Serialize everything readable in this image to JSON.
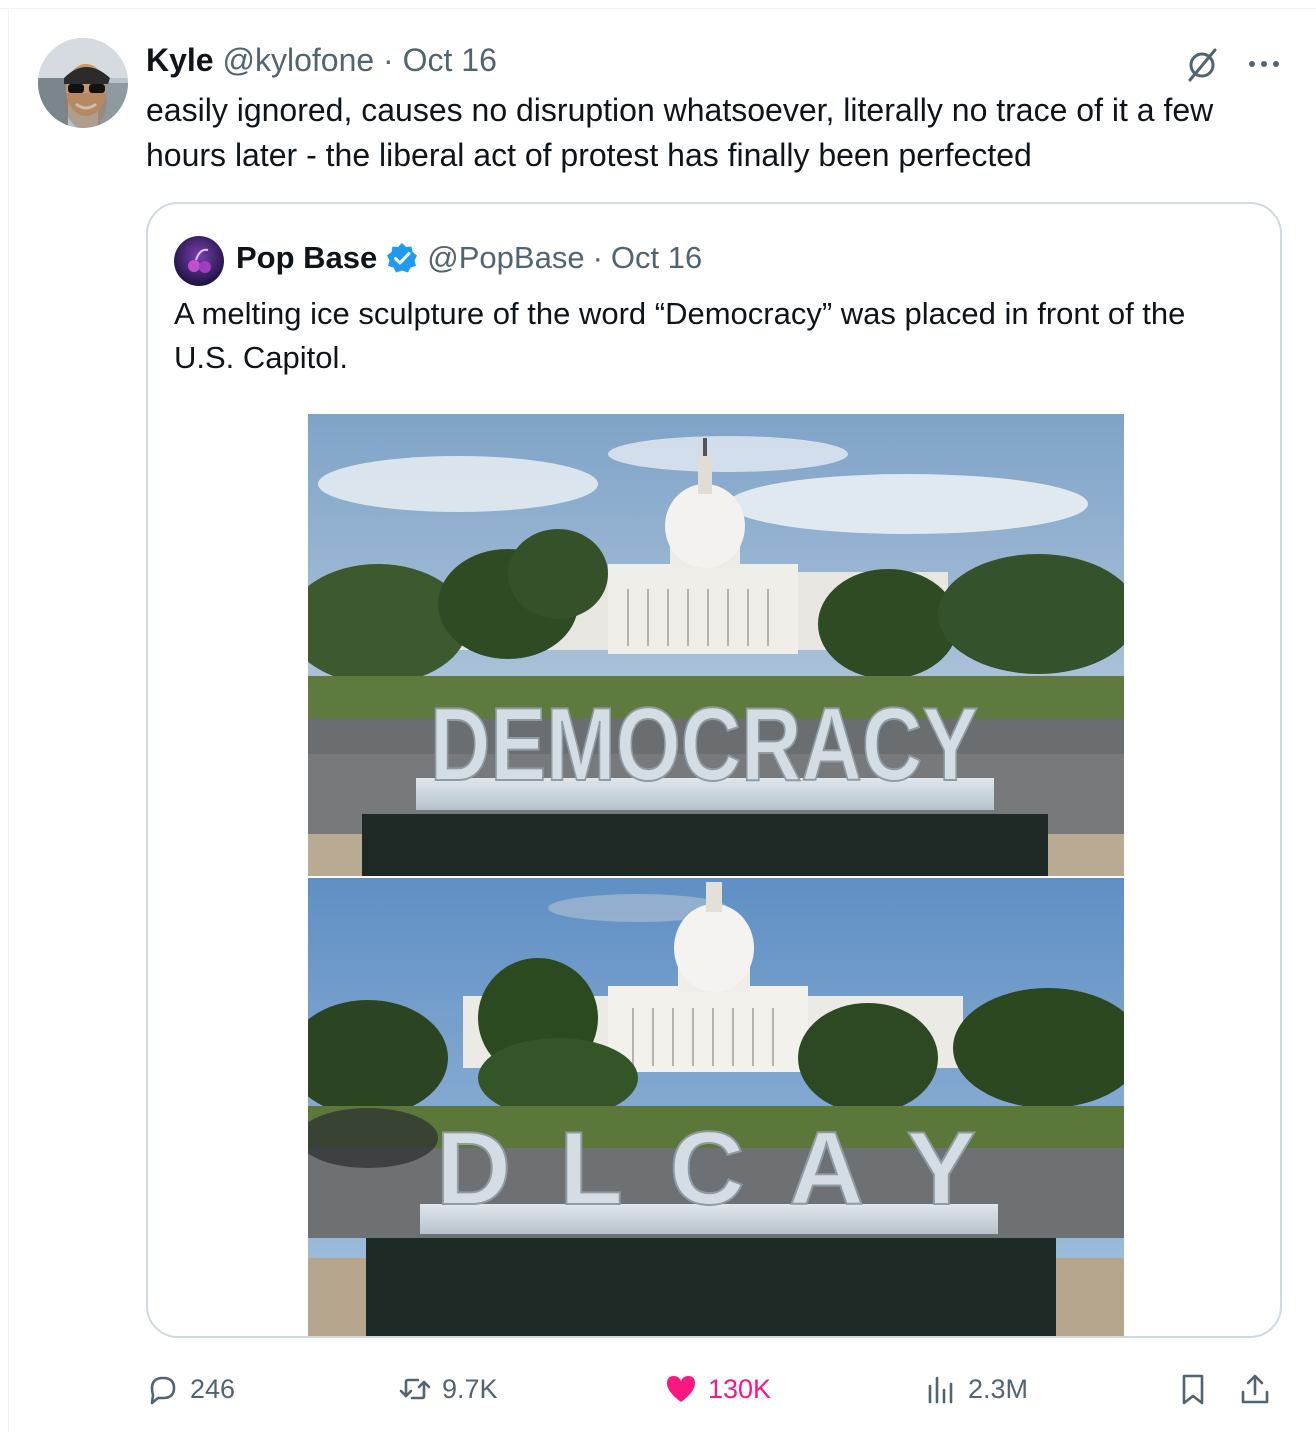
{
  "post": {
    "author_name": "Kyle",
    "author_handle": "@kylofone",
    "separator": "·",
    "date": "Oct 16",
    "text": "easily ignored, causes no disruption whatsoever, literally no trace of it a few hours later - the liberal act of protest has finally been perfected"
  },
  "quote": {
    "author_name": "Pop Base",
    "author_handle": "@PopBase",
    "separator": "·",
    "date": "Oct 16",
    "verified": true,
    "text": "A melting ice sculpture of the word “Democracy” was placed in front of the U.S. Capitol.",
    "images": {
      "top_sculpture_text": "DEMOCRACY",
      "bottom_sculpture_text": "D  L C A  Y"
    }
  },
  "actions": {
    "replies": "246",
    "reposts": "9.7K",
    "likes": "130K",
    "views": "2.3M"
  },
  "colors": {
    "text_primary": "#0f1419",
    "text_secondary": "#536471",
    "border": "#cfd9de",
    "like": "#f91880",
    "verified": "#1d9bf0"
  },
  "icons": [
    "grok-icon",
    "more-icon",
    "verified-icon",
    "reply-icon",
    "repost-icon",
    "like-icon",
    "views-icon",
    "bookmark-icon",
    "share-icon"
  ]
}
